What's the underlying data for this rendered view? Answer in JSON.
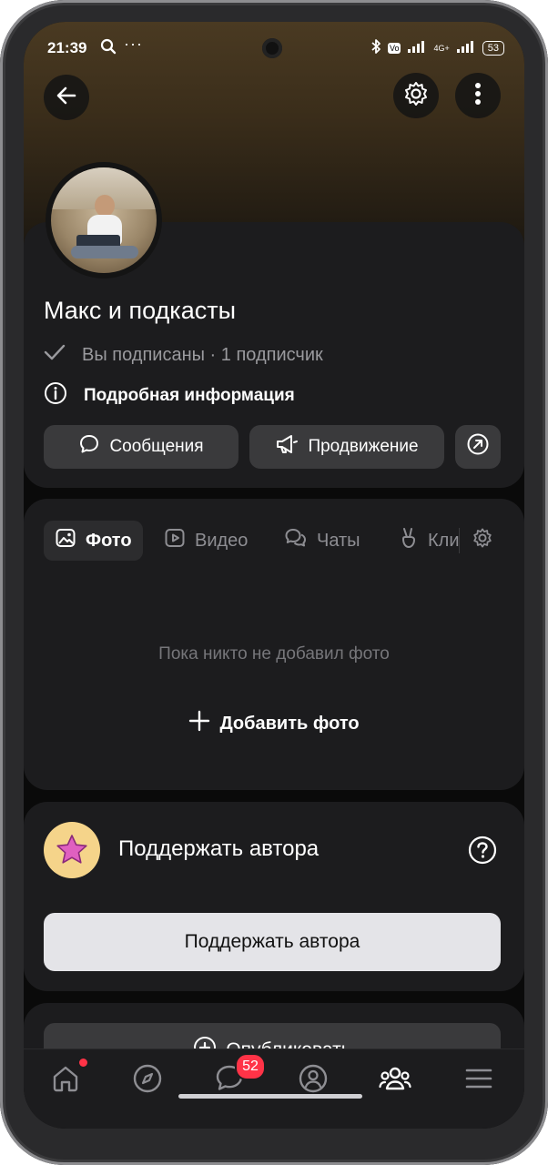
{
  "status": {
    "time": "21:39",
    "battery": "53",
    "network": "4G+"
  },
  "profile": {
    "name": "Макс и подкасты",
    "subscribed_text": "Вы подписаны · 1 подписчик",
    "info_label": "Подробная информация"
  },
  "actions": {
    "messages": "Сообщения",
    "promotion": "Продвижение"
  },
  "tabs": [
    {
      "label": "Фото",
      "icon": "photo-icon",
      "active": true
    },
    {
      "label": "Видео",
      "icon": "video-icon",
      "active": false
    },
    {
      "label": "Чаты",
      "icon": "chat-icon",
      "active": false
    },
    {
      "label": "Кли",
      "icon": "clip-icon",
      "active": false
    }
  ],
  "photos": {
    "empty_text": "Пока никто не добавил фото",
    "add_label": "Добавить фото"
  },
  "support": {
    "title": "Поддержать автора",
    "button_label": "Поддержать автора"
  },
  "publish": {
    "label": "Опубликовать"
  },
  "bottom_nav": {
    "messages_badge": "52",
    "items": [
      "home-icon",
      "compass-icon",
      "messages-icon",
      "profile-icon",
      "communities-icon",
      "menu-icon"
    ]
  },
  "colors": {
    "background": "#0a0a0a",
    "card": "#1c1c1e",
    "button": "#3a3a3c",
    "badge": "#ff3347",
    "support_button": "#e4e4e8"
  }
}
